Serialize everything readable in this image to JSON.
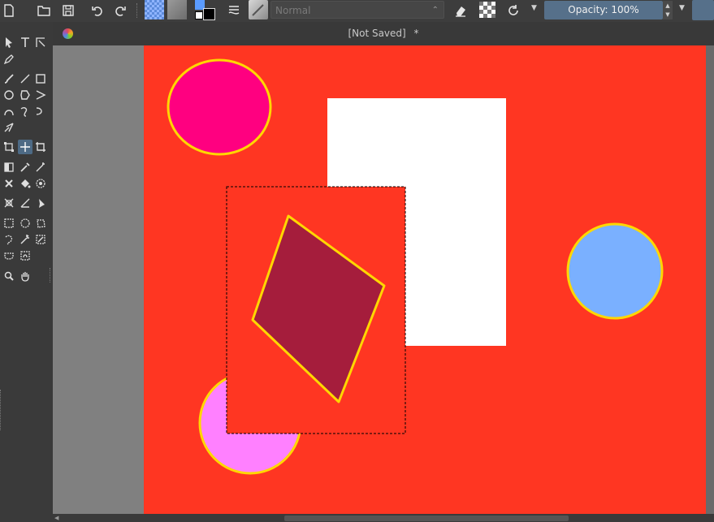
{
  "toolbar": {
    "blend_mode": "Normal",
    "opacity_label": "Opacity: 100%",
    "icons": [
      "new-document-icon",
      "open-folder-icon",
      "save-icon",
      "undo-icon",
      "redo-icon",
      "pattern-swatch",
      "gradient-swatch",
      "color-swatch-icon",
      "brush-settings-icon",
      "brush-preset-icon",
      "eraser-icon",
      "alpha-lock-icon",
      "reload-preset-icon"
    ]
  },
  "document": {
    "title": "[Not Saved]",
    "modified_marker": "*"
  },
  "colors": {
    "canvas_bg": "#ff3622",
    "magenta_ellipse": "#ff0080",
    "white_rect": "#ffffff",
    "blue_circle": "#7ab0ff",
    "pink_circle": "#ff80ff",
    "diamond": "#a51d3c",
    "outline": "#ffd700",
    "foreground": "#5a9bff",
    "background": "#000000"
  },
  "tools": [
    "select-shapes",
    "text",
    "calligraphy",
    "pen-fill",
    "freehand-brush",
    "line",
    "rectangle",
    "ellipse",
    "polygon",
    "polyline",
    "bezier",
    "freehand-path",
    "dynamic-brush",
    "multibrush",
    "transform",
    "move",
    "crop",
    "gradient",
    "color-picker",
    "smart-patch",
    "colorize-mask",
    "fill",
    "enclose-fill",
    "assistant",
    "measure",
    "reference",
    "rect-select",
    "ellipse-select",
    "polygon-select",
    "freehand-select",
    "contiguous-select",
    "similar-select",
    "bezier-select",
    "magnetic-select",
    "zoom",
    "pan"
  ]
}
